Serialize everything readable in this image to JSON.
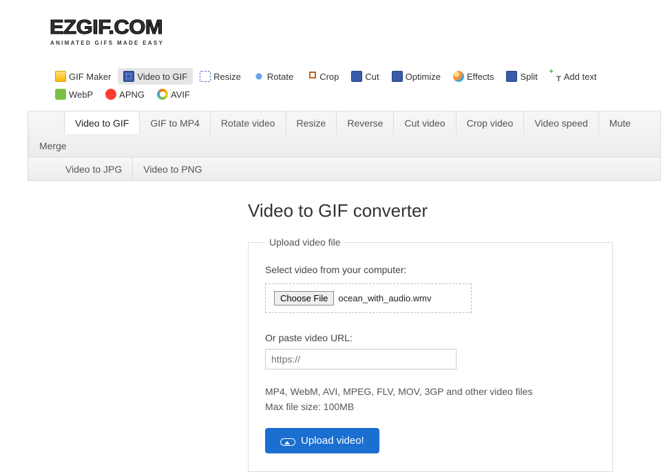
{
  "logo": {
    "main": "EZGIF.COM",
    "sub": "ANIMATED GIFS MADE EASY"
  },
  "primaryNav": {
    "gifMaker": "GIF Maker",
    "videoToGif": "Video to GIF",
    "resize": "Resize",
    "rotate": "Rotate",
    "crop": "Crop",
    "cut": "Cut",
    "optimize": "Optimize",
    "effects": "Effects",
    "split": "Split",
    "addText": "Add text",
    "webp": "WebP",
    "apng": "APNG",
    "avif": "AVIF"
  },
  "secondaryNav": {
    "videoToGif": "Video to GIF",
    "gifToMp4": "GIF to MP4",
    "rotateVideo": "Rotate video",
    "resize": "Resize",
    "reverse": "Reverse",
    "cutVideo": "Cut video",
    "cropVideo": "Crop video",
    "videoSpeed": "Video speed",
    "mute": "Mute",
    "merge": "Merge",
    "videoToJpg": "Video to JPG",
    "videoToPng": "Video to PNG"
  },
  "page": {
    "title": "Video to GIF converter",
    "legend": "Upload video file",
    "selectLabel": "Select video from your computer:",
    "chooseFile": "Choose File",
    "fileName": "ocean_with_audio.wmv",
    "orPaste": "Or paste video URL:",
    "urlPlaceholder": "https://",
    "formatsLine1": "MP4, WebM, AVI, MPEG, FLV, MOV, 3GP and other video files",
    "formatsLine2": "Max file size: 100MB",
    "uploadBtn": "Upload video!"
  }
}
